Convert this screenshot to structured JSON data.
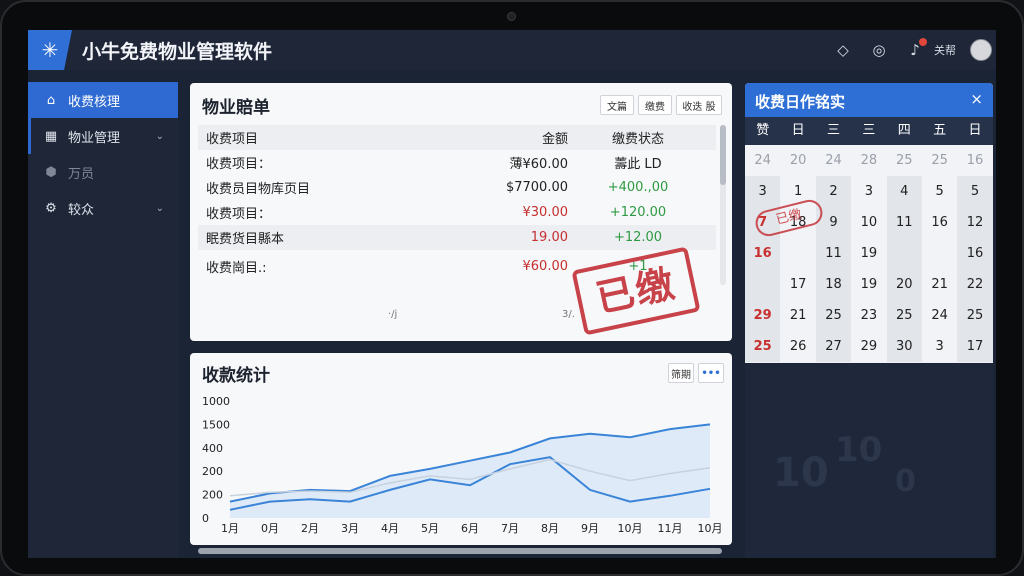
{
  "app": {
    "title": "小牛免费物业管理软件",
    "user_label": "关帮"
  },
  "sidebar": {
    "items": [
      {
        "label": "收费核理",
        "icon": "home-icon"
      },
      {
        "label": "物业管理",
        "icon": "grid-icon"
      },
      {
        "label": "万员",
        "icon": "cube-icon"
      },
      {
        "label": "较众",
        "icon": "gear-icon"
      }
    ]
  },
  "bill": {
    "title": "物业賠单",
    "buttons": [
      "文篇",
      "缴费",
      "收迭 股"
    ],
    "columns": [
      "收费项目",
      "金额",
      "缴费状态"
    ],
    "rows": [
      {
        "item": "收费项目：",
        "amount": "薄¥60.00",
        "status": "薵此 LD"
      },
      {
        "item": "收费员目物库页目",
        "amount": "$7700.00",
        "status": "+400.,00"
      },
      {
        "item": "收费项目：",
        "amount": "¥30.00",
        "status": "+120.00"
      },
      {
        "item": "眠费货目縣本",
        "amount": "19.00",
        "status": "+12.00"
      },
      {
        "item": "收费崗目.:",
        "amount": "¥60.00",
        "status": "+1"
      }
    ],
    "stamp": "已缴",
    "footer_left": "·/j",
    "footer_right": "3/."
  },
  "stats": {
    "title": "收款统计",
    "button": "筛期",
    "more": "•••"
  },
  "chart_data": {
    "type": "area",
    "title": "收款统计",
    "categories": [
      "1月",
      "0月",
      "2月",
      "3月",
      "4月",
      "5月",
      "6月",
      "7月",
      "8月",
      "9月",
      "10月",
      "11月",
      "10月"
    ],
    "y_tick_labels": [
      "1000",
      "1500",
      "400",
      "200",
      "200",
      "0"
    ],
    "series": [
      {
        "values": [
          140,
          210,
          240,
          230,
          360,
          420,
          490,
          560,
          680,
          720,
          690,
          760,
          800
        ]
      },
      {
        "values": [
          70,
          140,
          160,
          140,
          240,
          330,
          280,
          460,
          520,
          240,
          140,
          190,
          250
        ]
      },
      {
        "values": [
          190,
          220,
          230,
          220,
          300,
          360,
          330,
          420,
          500,
          400,
          320,
          380,
          430
        ]
      }
    ],
    "ylim": [
      0,
      1000
    ],
    "legend": "none",
    "grid": false
  },
  "calendar": {
    "title": "收费日作铭实",
    "close": "×",
    "dow": [
      "赞",
      "日",
      "三",
      "三",
      "四",
      "五",
      "日"
    ],
    "days": [
      "24",
      "20",
      "24",
      "28",
      "25",
      "25",
      "16",
      "3",
      "1",
      "2",
      "3",
      "4",
      "5",
      "5",
      "7",
      "18",
      "9",
      "10",
      "11",
      "16",
      "12",
      "16",
      "",
      "11",
      "19",
      "",
      "",
      "16",
      "",
      "17",
      "18",
      "19",
      "20",
      "21",
      "22",
      "29",
      "21",
      "25",
      "23",
      "25",
      "24",
      "25",
      "25",
      "26",
      "27",
      "29",
      "30",
      "3",
      "17"
    ],
    "stamp": "已缴"
  }
}
